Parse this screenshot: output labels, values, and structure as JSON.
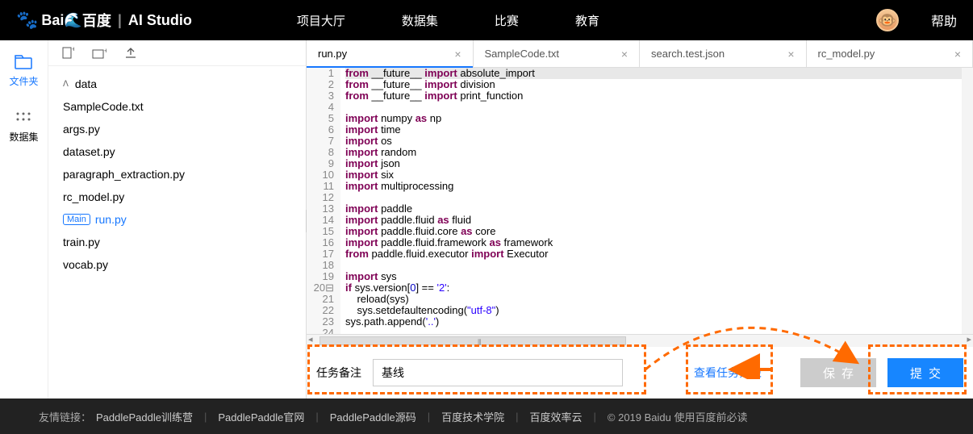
{
  "nav": {
    "logo_brand": "百度",
    "logo_suffix": "AI Studio",
    "items": [
      "项目大厅",
      "数据集",
      "比赛",
      "教育"
    ],
    "help": "帮助"
  },
  "sidebar_tabs": {
    "files": "文件夹",
    "datasets": "数据集"
  },
  "file_tree": {
    "folder": "data",
    "files": [
      "SampleCode.txt",
      "args.py",
      "dataset.py",
      "paragraph_extraction.py",
      "rc_model.py"
    ],
    "main_badge": "Main",
    "main_file": "run.py",
    "rest": [
      "train.py",
      "vocab.py"
    ]
  },
  "tabs": [
    {
      "label": "run.py",
      "active": true
    },
    {
      "label": "SampleCode.txt",
      "active": false
    },
    {
      "label": "search.test.json",
      "active": false
    },
    {
      "label": "rc_model.py",
      "active": false
    }
  ],
  "code_lines": 24,
  "bottom": {
    "remark_label": "任务备注",
    "remark_value": "基线",
    "view_tasks": "查看任务列表",
    "save": "保存",
    "submit": "提交"
  },
  "footer": {
    "prefix": "友情链接：",
    "links": [
      "PaddlePaddle训练营",
      "PaddlePaddle官网",
      "PaddlePaddle源码",
      "百度技术学院",
      "百度效率云"
    ],
    "copyright": "© 2019 Baidu 使用百度前必读"
  }
}
